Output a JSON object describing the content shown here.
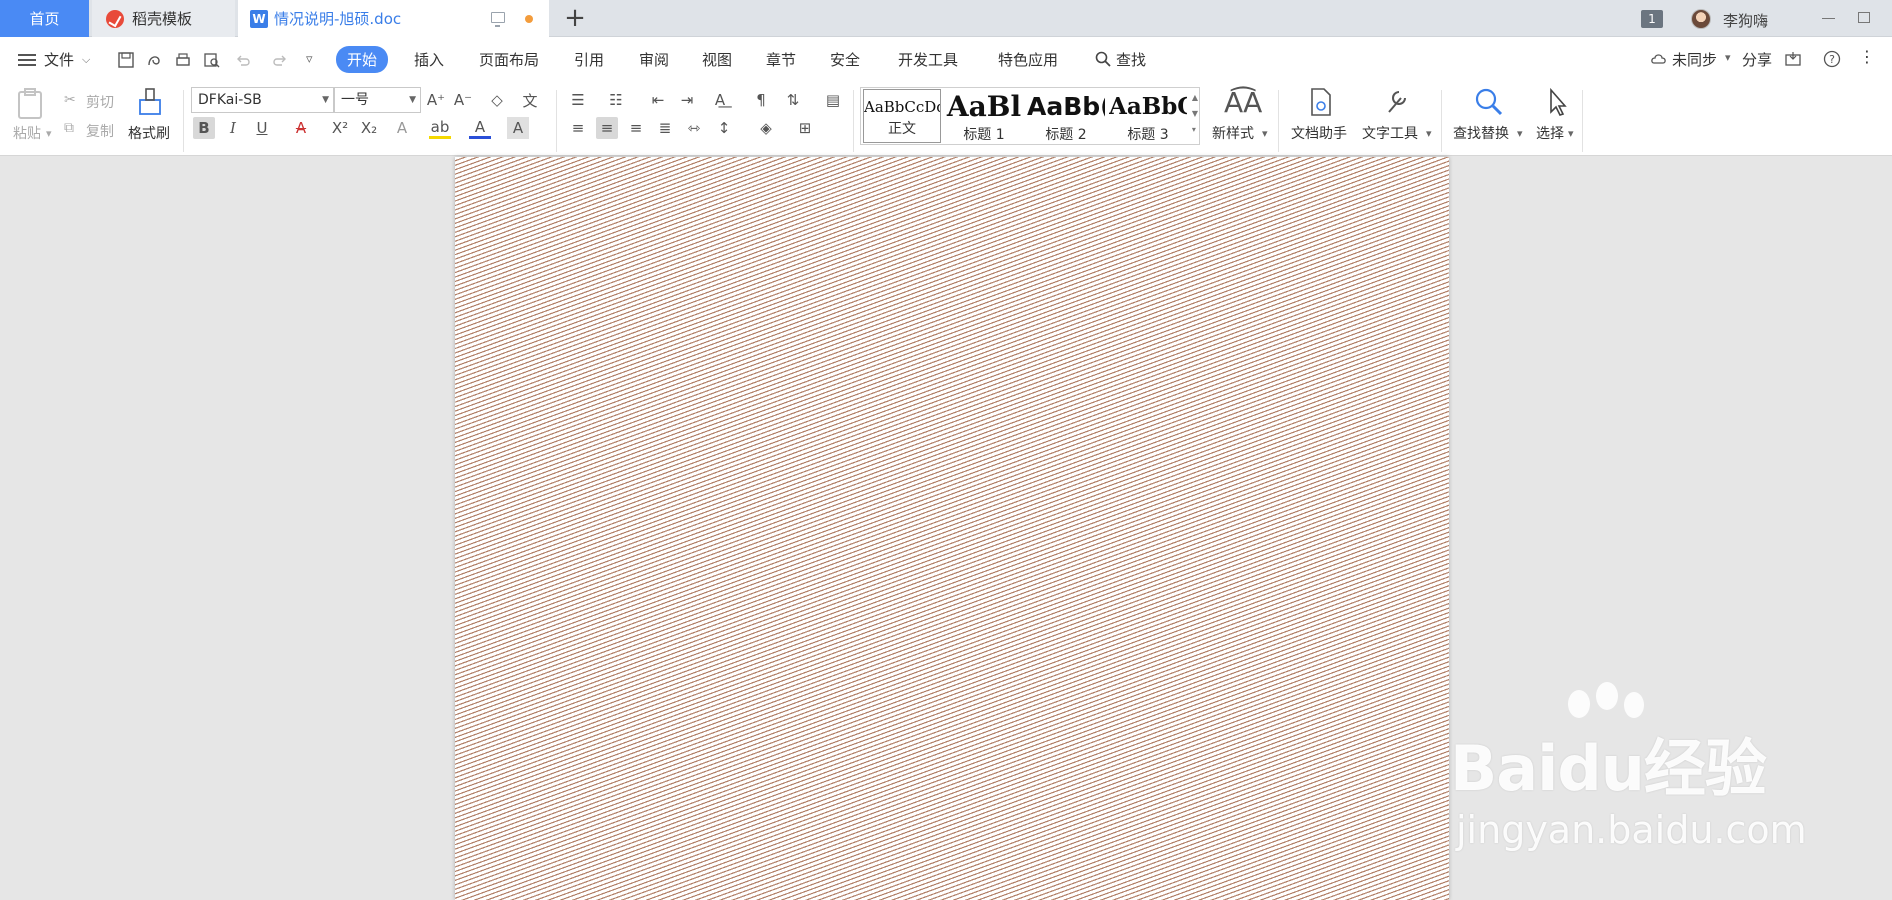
{
  "tabs": {
    "home": "首页",
    "daoke": "稻壳模板",
    "doc": "情况说明-旭硕.doc",
    "add": "+"
  },
  "titlebar": {
    "notification_count": "1",
    "username": "李狗嗨"
  },
  "menu": {
    "file": "文件",
    "items": [
      "开始",
      "插入",
      "页面布局",
      "引用",
      "审阅",
      "视图",
      "章节",
      "安全",
      "开发工具",
      "特色应用"
    ],
    "search": "查找",
    "sync": "未同步",
    "share": "分享"
  },
  "ribbon": {
    "paste": "粘贴",
    "cut": "剪切",
    "copy": "复制",
    "format_painter": "格式刷",
    "font_name": "DFKai-SB",
    "font_size": "一号",
    "styles": [
      {
        "sample": "AaBbCcDd",
        "label": "正文"
      },
      {
        "sample": "AaBl",
        "label": "标题 1"
      },
      {
        "sample": "AaBb(",
        "label": "标题 2"
      },
      {
        "sample": "AaBbC",
        "label": "标题 3"
      }
    ],
    "new_style": "新样式",
    "doc_assistant": "文档助手",
    "text_tools": "文字工具",
    "find_replace": "查找替换",
    "select": "选择"
  },
  "watermark": {
    "main": "Baidu经验",
    "sub": "jingyan.baidu.com"
  },
  "colors": {
    "accent": "#4a8af4",
    "doc_tab_text": "#3a7ee8",
    "unsaved_dot": "#f39c3c",
    "page_hatch": "#b3826a"
  }
}
